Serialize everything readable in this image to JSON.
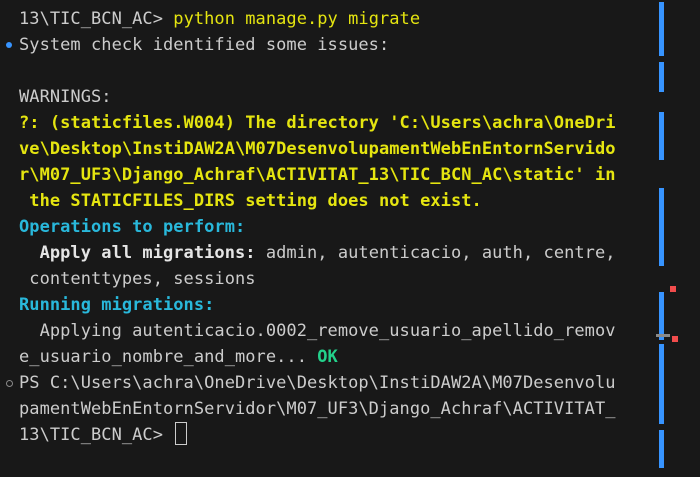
{
  "terminal": {
    "line_00": "13\\TIC_BCN_AC> ",
    "line_00_cmd": "python manage.py migrate",
    "line_01": "System check identified some issues:",
    "line_03": "WARNINGS:",
    "line_04": "?: (staticfiles.W004) The directory 'C:\\Users\\achra\\OneDri",
    "line_05": "ve\\Desktop\\InstiDAW2A\\M07DesenvolupamentWebEnEntornServido",
    "line_06": "r\\M07_UF3\\Django_Achraf\\ACTIVITAT_13\\TIC_BCN_AC\\static' in",
    "line_07": " the STATICFILES_DIRS setting does not exist.",
    "line_08": "Operations to perform:",
    "line_09_label": "  Apply all migrations:",
    "line_09_rest": " admin, autenticacio, auth, centre,",
    "line_10": " contenttypes, sessions",
    "line_11": "Running migrations:",
    "line_12": "  Applying autenticacio.0002_remove_usuario_apellido_remov",
    "line_13": "e_usuario_nombre_and_more... ",
    "line_13_ok": "OK",
    "line_14": "PS C:\\Users\\achra\\OneDrive\\Desktop\\InstiDAW2A\\M07Desenvolu",
    "line_15": "pamentWebEnEntornServidor\\M07_UF3\\Django_Achraf\\ACTIVITAT_",
    "line_16": "13\\TIC_BCN_AC> "
  },
  "colors": {
    "background": "#181818",
    "text": "#cccccc",
    "warning": "#e5e510",
    "info": "#29b8db",
    "success": "#23d18b",
    "scrollbar_marker": "#3794ff",
    "scrollbar_error": "#f14c4c"
  }
}
